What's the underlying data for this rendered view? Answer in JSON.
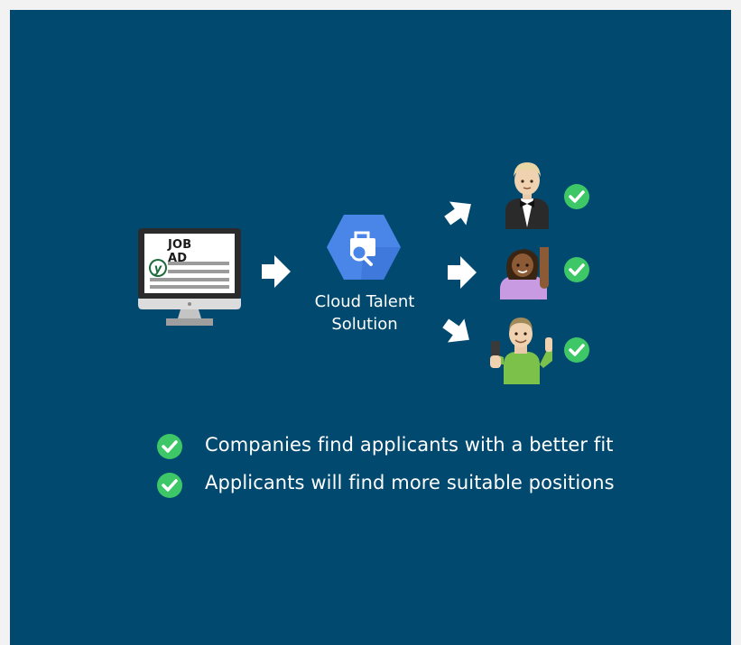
{
  "job_ad": {
    "title": "JOB AD",
    "logo_letter": "y"
  },
  "service": {
    "line1": "Cloud Talent",
    "line2": "Solution",
    "icon": "briefcase-search-icon"
  },
  "applicants": [
    {
      "name": "person-in-tuxedo",
      "icon": "applicant-tuxedo-icon",
      "status": "check"
    },
    {
      "name": "woman-raising-hand",
      "icon": "applicant-raising-hand-icon",
      "status": "check"
    },
    {
      "name": "man-with-phone-thumbs-up",
      "icon": "applicant-thumbs-up-icon",
      "status": "check"
    }
  ],
  "benefits": [
    "Companies find applicants with a better fit",
    "Applicants will find more suitable positions"
  ],
  "colors": {
    "background": "#01496f",
    "frame": "#f2f2f2",
    "check": "#3ec767",
    "service_hex": "#4a86e8",
    "arrow": "#ffffff"
  }
}
